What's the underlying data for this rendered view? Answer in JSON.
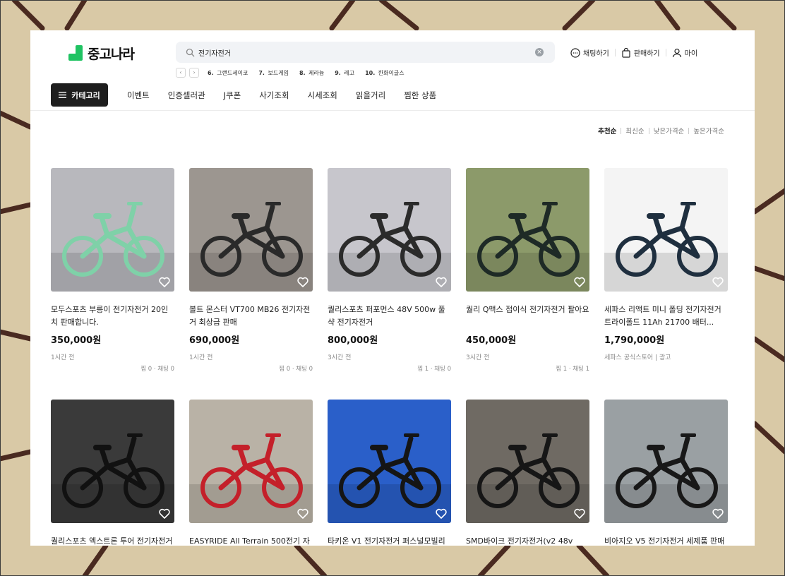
{
  "brand": {
    "name": "중고나라",
    "color": "#1fc362"
  },
  "search": {
    "value": "전기자전거",
    "placeholder": ""
  },
  "popular_keywords": [
    {
      "rank": "6.",
      "text": "그랜드세이코"
    },
    {
      "rank": "7.",
      "text": "보드게임"
    },
    {
      "rank": "8.",
      "text": "제라늄"
    },
    {
      "rank": "9.",
      "text": "레고"
    },
    {
      "rank": "10.",
      "text": "한화이글스"
    }
  ],
  "actions": {
    "chat": "채팅하기",
    "sell": "판매하기",
    "my": "마이"
  },
  "nav": {
    "category_label": "카테고리",
    "items": [
      "이벤트",
      "인증셀러관",
      "J쿠폰",
      "사기조회",
      "시세조회",
      "읽을거리",
      "찜한 상품"
    ]
  },
  "sort": {
    "items": [
      "추천순",
      "최신순",
      "낮은가격순",
      "높은가격순"
    ],
    "active": 0
  },
  "products": [
    {
      "title": "모두스포츠 부릉이 전기자전거 20인치 판매합니다.",
      "price": "350,000원",
      "meta": "1시간 전",
      "stats": "찜 0 · 채팅 0",
      "bg": "#b8b8bd",
      "bike": "#7fd1a8"
    },
    {
      "title": "볼트 몬스터 VT700 MB26 전기자전거 최상급 판매",
      "price": "690,000원",
      "meta": "1시간 전",
      "stats": "찜 0 · 채팅 0",
      "bg": "#9c9690",
      "bike": "#2a2a2a"
    },
    {
      "title": "퀄리스포츠 퍼포먼스 48V 500w 풀샥 전기자전거",
      "price": "800,000원",
      "meta": "3시간 전",
      "stats": "찜 1 · 채팅 0",
      "bg": "#c7c6cc",
      "bike": "#2b2b2b"
    },
    {
      "title": "퀄리 Q맥스 접이식 전기자전거 팔아요",
      "price": "450,000원",
      "meta": "3시간 전",
      "stats": "찜 1 · 채팅 1",
      "bg": "#8c9a6a",
      "bike": "#1e2a26"
    },
    {
      "title": "세파스 리액트 미니 폴딩 전기자전거 트라이폴드 11Ah 21700 배터...",
      "price": "1,790,000원",
      "meta": "세파스 공식스토어 | 광고",
      "stats": "",
      "bg": "#f4f4f4",
      "bike": "#1f2f3f"
    },
    {
      "title": "퀄리스포츠 엑스트론 투어 전기자전거",
      "price": "",
      "meta": "",
      "stats": "",
      "bg": "#3a3a3a",
      "bike": "#111111"
    },
    {
      "title": "EASYRIDE All Terrain 500전기 자",
      "price": "",
      "meta": "",
      "stats": "",
      "bg": "#b9b2a6",
      "bike": "#c4202a"
    },
    {
      "title": "타키온 V1 전기자전거 퍼스널모빌리",
      "price": "",
      "meta": "",
      "stats": "",
      "bg": "#2a5fc9",
      "bike": "#151515"
    },
    {
      "title": "SMD바이크 전기자전거(v2 48v",
      "price": "",
      "meta": "",
      "stats": "",
      "bg": "#6f6a63",
      "bike": "#161616"
    },
    {
      "title": "비아지오 V5 전기자전거 세제품 판매",
      "price": "",
      "meta": "",
      "stats": "",
      "bg": "#9aa0a3",
      "bike": "#181818"
    }
  ]
}
